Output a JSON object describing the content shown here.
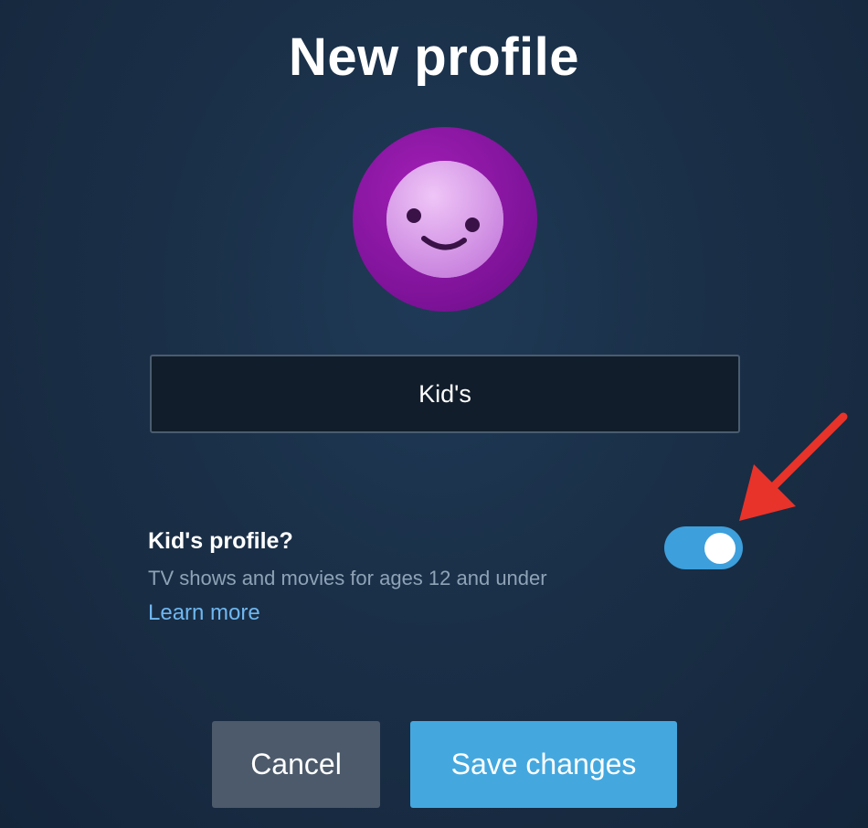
{
  "title": "New profile",
  "avatar": {
    "icon": "smiley-face-icon",
    "colors": {
      "outer": "#8a149f",
      "face": "#d99bea"
    }
  },
  "profile_name": {
    "value": "Kid's"
  },
  "kids_profile": {
    "label": "Kid's profile?",
    "description": "TV shows and movies for ages 12 and under",
    "learn_more": "Learn more",
    "enabled": true
  },
  "buttons": {
    "cancel": "Cancel",
    "save": "Save changes"
  },
  "colors": {
    "accent": "#44a8df",
    "toggle_on": "#3d9fdc",
    "link": "#6fb7f0",
    "annotation_arrow": "#e8332a"
  }
}
